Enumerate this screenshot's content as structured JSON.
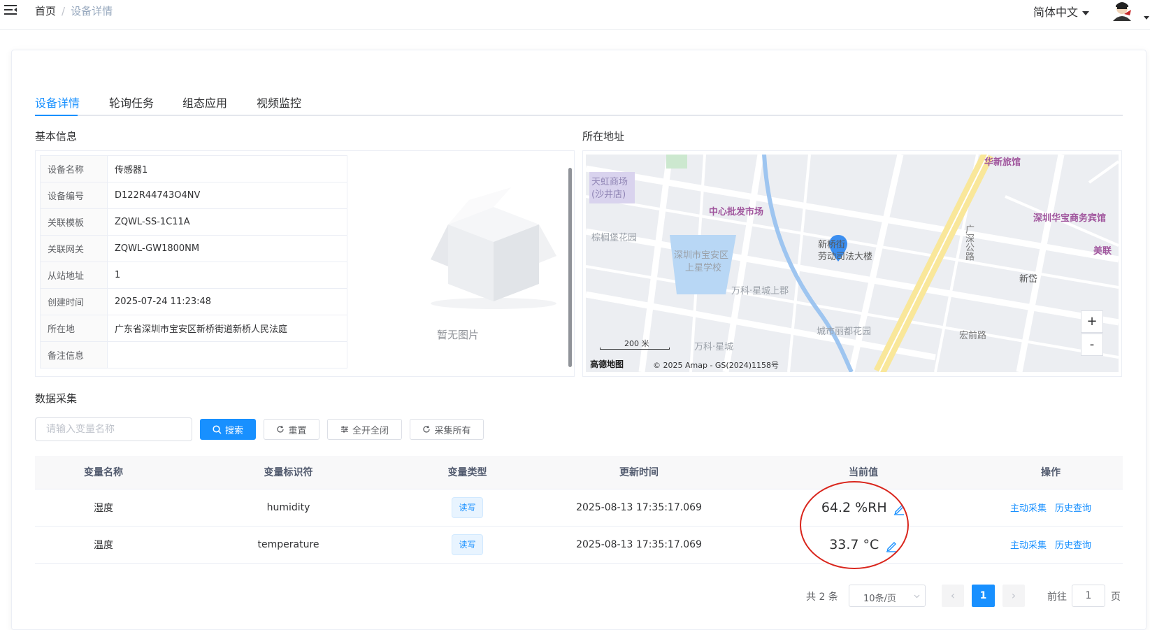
{
  "breadcrumb": {
    "home": "首页",
    "sep": "/",
    "current": "设备详情"
  },
  "header": {
    "language": "简体中文"
  },
  "tabs": [
    {
      "label": "设备详情",
      "active": true
    },
    {
      "label": "轮询任务",
      "active": false
    },
    {
      "label": "组态应用",
      "active": false
    },
    {
      "label": "视频监控",
      "active": false
    }
  ],
  "basic_info": {
    "title": "基本信息",
    "rows": [
      {
        "key": "设备名称",
        "value": "传感器1"
      },
      {
        "key": "设备编号",
        "value": "D122R44743O4NV"
      },
      {
        "key": "关联模板",
        "value": "ZQWL-SS-1C11A"
      },
      {
        "key": "关联网关",
        "value": "ZQWL-GW1800NM"
      },
      {
        "key": "从站地址",
        "value": "1"
      },
      {
        "key": "创建时间",
        "value": "2025-07-24 11:23:48"
      },
      {
        "key": "所在地",
        "value": "广东省深圳市宝安区新桥街道新桥人民法庭"
      },
      {
        "key": "备注信息",
        "value": ""
      }
    ],
    "no_image": "暂无图片"
  },
  "location": {
    "title": "所在地址",
    "map_labels": {
      "poi1": "中心批发市场",
      "poi2": "棕榈堡花园",
      "poi3": "深圳市宝安区",
      "poi3b": "上星学校",
      "poi4": "万科·星城上郡",
      "poi5": "新桥街",
      "poi5b": "劳动司法大楼",
      "poi6": "深圳华宝商务宾馆",
      "poi7": "华新旅馆",
      "poi8": "美联",
      "poi9": "新岱",
      "poi10": "城市丽都花园",
      "poi11": "万科·星城",
      "poi12": "宏前路",
      "poi13": "广深公路",
      "poi14": "天虹商场",
      "poi14b": "(沙井店)",
      "scale": "200 米",
      "brand": "高德地图",
      "copyright": "© 2025 Amap - GS(2024)1158号",
      "zoom_in": "+",
      "zoom_out": "-"
    }
  },
  "data_collect": {
    "title": "数据采集",
    "search_placeholder": "请输入变量名称",
    "buttons": {
      "search": "搜索",
      "reset": "重置",
      "toggle": "全开全闭",
      "collect_all": "采集所有"
    },
    "columns": [
      "变量名称",
      "变量标识符",
      "变量类型",
      "更新时间",
      "当前值",
      "操作"
    ],
    "rows": [
      {
        "name": "湿度",
        "identifier": "humidity",
        "type": "读写",
        "updated": "2025-08-13 17:35:17.069",
        "value": "64.2 %RH",
        "action1": "主动采集",
        "action2": "历史查询"
      },
      {
        "name": "温度",
        "identifier": "temperature",
        "type": "读写",
        "updated": "2025-08-13 17:35:17.069",
        "value": "33.7 °C",
        "action1": "主动采集",
        "action2": "历史查询"
      }
    ],
    "pagination": {
      "total": "共 2 条",
      "page_size": "10条/页",
      "current_page": "1",
      "goto_label": "前往",
      "goto_value": "1",
      "page_suffix": "页"
    }
  }
}
